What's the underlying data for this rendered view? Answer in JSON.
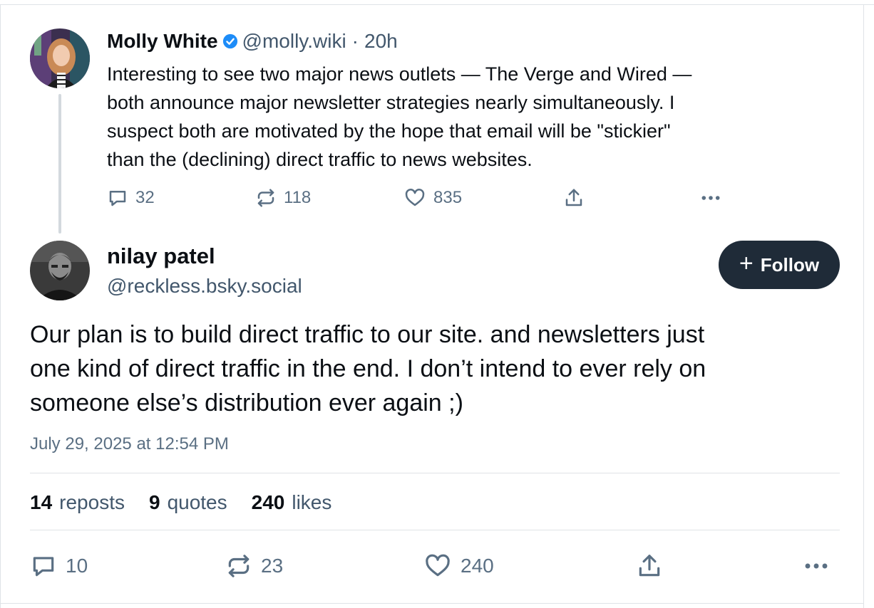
{
  "parent_post": {
    "author_name": "Molly White",
    "handle": "@molly.wiki",
    "separator": "·",
    "time": "20h",
    "text_lines": [
      "Interesting to see two major news outlets — The Verge and Wired —",
      "both announce major newsletter strategies nearly simultaneously. I",
      "suspect both are motivated by the hope that email will be \"stickier\"",
      "than the (declining) direct traffic to news websites."
    ],
    "actions": {
      "replies": "32",
      "reposts": "118",
      "likes": "835"
    }
  },
  "main_post": {
    "author_name": "nilay patel",
    "handle": "@reckless.bsky.social",
    "follow_label": "Follow",
    "text_lines": [
      "Our plan is to build direct traffic to our site. and newsletters just",
      "one kind of direct traffic in the end. I don’t intend to ever rely on",
      "someone else’s distribution ever again ;)"
    ],
    "timestamp": "July 29, 2025 at 12:54 PM",
    "stats": {
      "reposts_count": "14",
      "reposts_label": "reposts",
      "quotes_count": "9",
      "quotes_label": "quotes",
      "likes_count": "240",
      "likes_label": "likes"
    },
    "actions": {
      "replies": "10",
      "reposts": "23",
      "likes": "240"
    }
  },
  "colors": {
    "verified": "#1d8cf8",
    "follow_button": "#1f2b38",
    "muted_text": "#42576c",
    "icon": "#5a6f83"
  },
  "icons": [
    "reply-icon",
    "repost-icon",
    "like-icon",
    "share-icon",
    "more-icon",
    "verified-icon",
    "plus-icon"
  ]
}
